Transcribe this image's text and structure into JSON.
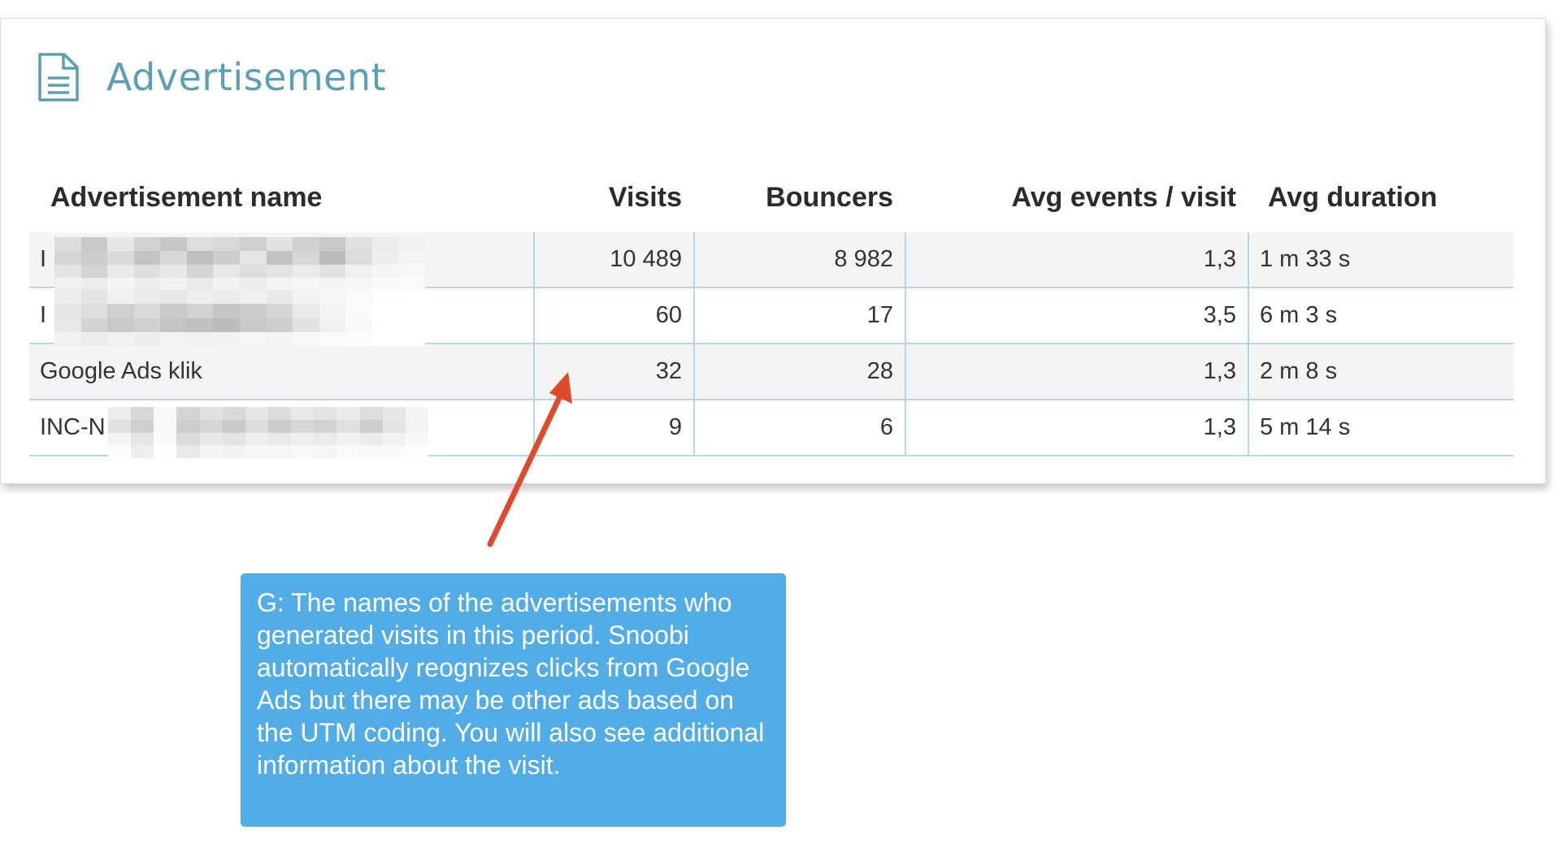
{
  "panel": {
    "title": "Advertisement"
  },
  "table": {
    "headers": {
      "name": "Advertisement name",
      "visits": "Visits",
      "bouncers": "Bouncers",
      "avg_events": "Avg events / visit",
      "avg_duration": "Avg duration"
    },
    "rows": [
      {
        "name": "I",
        "visits": "10 489",
        "bouncers": "8 982",
        "avg_events": "1,3",
        "avg_duration": "1 m 33 s"
      },
      {
        "name": "I",
        "visits": "60",
        "bouncers": "17",
        "avg_events": "3,5",
        "avg_duration": "6 m 3 s"
      },
      {
        "name": "Google Ads klik",
        "visits": "32",
        "bouncers": "28",
        "avg_events": "1,3",
        "avg_duration": "2 m 8 s"
      },
      {
        "name": "INC-N",
        "visits": "9",
        "bouncers": "6",
        "avg_events": "1,3",
        "avg_duration": "5 m 14 s"
      }
    ]
  },
  "callout": {
    "text": "G: The names of the advertisements who generated visits in this period. Snoobi automatically reognizes clicks from Google Ads but there may be other ads based on the UTM coding. You will also see additional information about the visit."
  },
  "colors": {
    "title": "#5a9fb3",
    "grid_line": "#b6d6ee",
    "row_shade": "#f4f4f4",
    "callout_bg": "#52ace6",
    "arrow": "#e04a2c"
  },
  "icons": {
    "panel_icon": "document-icon"
  }
}
